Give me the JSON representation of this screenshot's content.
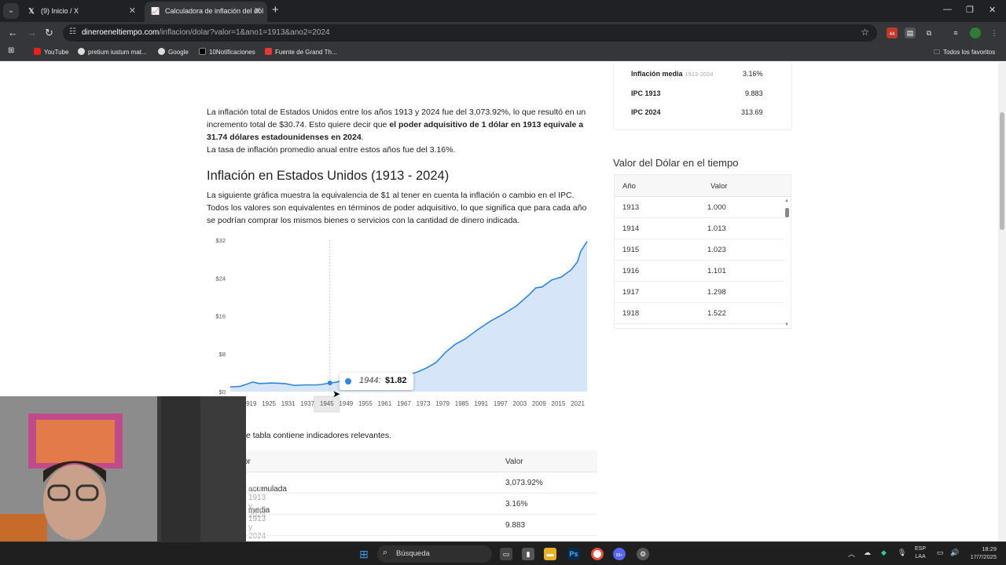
{
  "browser": {
    "tabs": [
      {
        "favicon": "X",
        "title": "(9) Inicio / X"
      },
      {
        "favicon": "calculator-chart",
        "title": "Calculadora de inflación del dól"
      }
    ],
    "url_host": "dineroeneltiempo.com",
    "url_path": "/inflacion/dolar?valor=1&ano1=1913&ano2=2024",
    "ext_badge": "44",
    "bookmarks": [
      "YouTube",
      "pretium iustum mat...",
      "Google",
      "10Notificaciones",
      "Fuente de Grand Th..."
    ],
    "all_bookmarks": "Todos los favoritos"
  },
  "summary": {
    "p1_a": "La inflación total de Estados Unidos entre los años 1913 y 2024 fue del 3,073.92%, lo que resultó en un incremento total de $30.74. Esto quiere decir que ",
    "p1_bold": "el poder adquisitivo de 1 dólar en 1913 equivale a 31.74 dólares estadounidenses en 2024",
    "p1_end": ".",
    "p2": "La tasa de inflación promedio anual entre estos años fue del 3.16%."
  },
  "section": {
    "title": "Inflación en Estados Unidos (1913 - 2024)",
    "desc": "La siguiente gráfica muestra la equivalencia de $1 al tener en cuenta la inflación o cambio en el IPC. Todos los valores son equivalentes en términos de poder adquisitivo, lo que significa que para cada año se podrían comprar los mismos bienes o servicios con la cantidad de dinero indicada."
  },
  "stats": [
    {
      "label": "Inflación media",
      "sub": "1913-2024",
      "value": "3.16%"
    },
    {
      "label": "IPC 1913",
      "sub": "",
      "value": "9.883"
    },
    {
      "label": "IPC 2024",
      "sub": "",
      "value": "313.69"
    }
  ],
  "dollar_table": {
    "title": "Valor del Dólar en el tiempo",
    "col_year": "Año",
    "col_value": "Valor",
    "rows": [
      {
        "year": "1913",
        "value": "1.000"
      },
      {
        "year": "1914",
        "value": "1.013"
      },
      {
        "year": "1915",
        "value": "1.023"
      },
      {
        "year": "1916",
        "value": "1.101"
      },
      {
        "year": "1917",
        "value": "1.298"
      },
      {
        "year": "1918",
        "value": "1.522"
      }
    ]
  },
  "chart_data": {
    "type": "area",
    "title": "",
    "xlabel": "",
    "ylabel": "",
    "color": "#2e86de",
    "fill": "#cfe2f7",
    "xlim": [
      1913,
      2024
    ],
    "ylim": [
      0,
      32
    ],
    "y_ticks": [
      0,
      8,
      16,
      24,
      32
    ],
    "y_tick_labels": [
      "$0",
      "$8",
      "$16",
      "$24",
      "$32"
    ],
    "x_tick_labels": [
      "1913",
      "1919",
      "1925",
      "1931",
      "1937",
      "1945",
      "1949",
      "1955",
      "1961",
      "1967",
      "1973",
      "1979",
      "1985",
      "1991",
      "1997",
      "2003",
      "2009",
      "2015",
      "2021"
    ],
    "x": [
      1913,
      1916,
      1918,
      1920,
      1922,
      1926,
      1930,
      1933,
      1936,
      1940,
      1942,
      1944,
      1946,
      1948,
      1952,
      1956,
      1960,
      1965,
      1968,
      1971,
      1974,
      1977,
      1980,
      1983,
      1986,
      1990,
      1994,
      1998,
      2002,
      2006,
      2008,
      2010,
      2013,
      2016,
      2019,
      2021,
      2022,
      2024
    ],
    "y": [
      1.0,
      1.1,
      1.52,
      2.02,
      1.69,
      1.8,
      1.69,
      1.31,
      1.41,
      1.41,
      1.58,
      1.82,
      1.98,
      2.4,
      2.68,
      2.7,
      2.99,
      3.16,
      3.5,
      4.08,
      4.98,
      6.14,
      8.33,
      10.0,
      11.1,
      13.1,
      14.9,
      16.4,
      18.1,
      20.5,
      21.9,
      22.1,
      23.6,
      24.2,
      25.7,
      27.4,
      29.6,
      31.74
    ],
    "hover": {
      "year": "1944:",
      "value": "$1.82"
    },
    "grid": false,
    "legend": "none"
  },
  "indicators": {
    "intro": "e tabla contiene indicadores relevantes.",
    "col_name": "or",
    "col_value": "Valor",
    "rows": [
      {
        "name": "acumulada",
        "sub": "entre 1913 y 2024",
        "value": "3,073.92%"
      },
      {
        "name": "media",
        "sub": "entre 1913 y 2024",
        "value": "3.16%"
      },
      {
        "name": "",
        "sub": "",
        "value": "9.883"
      }
    ]
  },
  "taskbar": {
    "search": "Búsqueda",
    "lang1": "ESP",
    "lang2": "LAA",
    "time": "18:29",
    "date": "17/7/2025",
    "badge": "99+"
  }
}
